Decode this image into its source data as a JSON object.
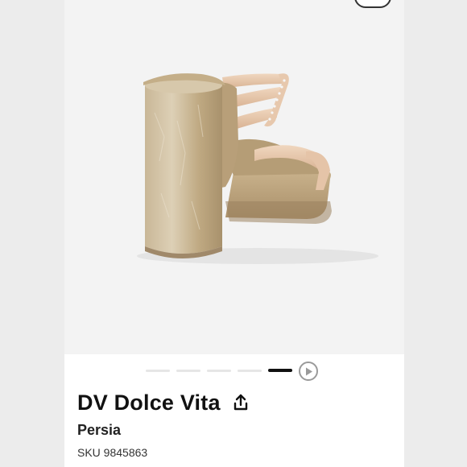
{
  "product": {
    "brand": "DV Dolce Vita",
    "model": "Persia",
    "sku": "SKU 9845863"
  },
  "gallery": {
    "image_subject": "metallic gold block-heel platform sandal, rear view",
    "slide_count": 5,
    "active_slide": 5
  },
  "icons": {
    "share": "share-icon",
    "play": "play-icon"
  },
  "colors": {
    "accent": "#111111",
    "inactive_dot": "#e6e6e6",
    "shoe_gold": "#cbb99a",
    "strap_nude": "#e7c8ad"
  }
}
